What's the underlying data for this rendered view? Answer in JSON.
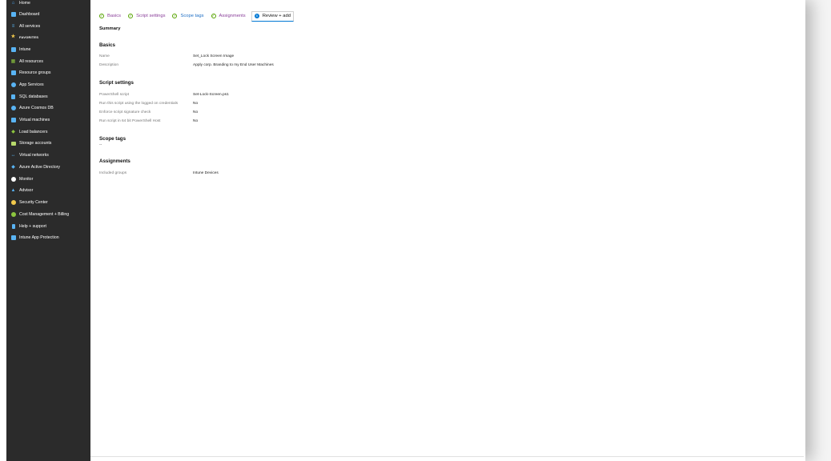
{
  "sidebar": {
    "items": [
      {
        "label": "Home",
        "icon": "home-icon",
        "color": "#4aa3f0"
      },
      {
        "label": "Dashboard",
        "icon": "dashboard-icon",
        "color": "#59b4f4"
      },
      {
        "label": "All services",
        "icon": "list-icon",
        "color": "#59b4f4"
      },
      {
        "label": "FAVORITES",
        "icon": "star-icon",
        "color": "#f2c94c"
      },
      {
        "label": "Intune",
        "icon": "intune-icon",
        "color": "#59b4f4"
      },
      {
        "label": "All resources",
        "icon": "grid-icon",
        "color": "#8dc63f"
      },
      {
        "label": "Resource groups",
        "icon": "resource-group-icon",
        "color": "#59b4f4"
      },
      {
        "label": "App Services",
        "icon": "app-services-icon",
        "color": "#59b4f4"
      },
      {
        "label": "SQL databases",
        "icon": "sql-database-icon",
        "color": "#59b4f4"
      },
      {
        "label": "Azure Cosmos DB",
        "icon": "cosmos-db-icon",
        "color": "#59b4f4"
      },
      {
        "label": "Virtual machines",
        "icon": "virtual-machine-icon",
        "color": "#59b4f4"
      },
      {
        "label": "Load balancers",
        "icon": "load-balancer-icon",
        "color": "#8dc63f"
      },
      {
        "label": "Storage accounts",
        "icon": "storage-icon",
        "color": "#b7d96b"
      },
      {
        "label": "Virtual networks",
        "icon": "virtual-network-icon",
        "color": "#59b4f4"
      },
      {
        "label": "Azure Active Directory",
        "icon": "active-directory-icon",
        "color": "#59b4f4"
      },
      {
        "label": "Monitor",
        "icon": "monitor-icon",
        "color": "#ffffff"
      },
      {
        "label": "Advisor",
        "icon": "advisor-icon",
        "color": "#59b4f4"
      },
      {
        "label": "Security Center",
        "icon": "security-center-icon",
        "color": "#f2c94c"
      },
      {
        "label": "Cost Management + Billing",
        "icon": "cost-management-icon",
        "color": "#8dc63f"
      },
      {
        "label": "Help + support",
        "icon": "help-icon",
        "color": "#59b4f4"
      },
      {
        "label": "Intune App Protection",
        "icon": "app-protection-icon",
        "color": "#59b4f4"
      }
    ]
  },
  "tabs": [
    {
      "label": "Basics",
      "state": "done"
    },
    {
      "label": "Script settings",
      "state": "done"
    },
    {
      "label": "Scope tags",
      "state": "done"
    },
    {
      "label": "Assignments",
      "state": "done"
    },
    {
      "label": "Review + add",
      "state": "active",
      "number": "5"
    }
  ],
  "summary": {
    "title": "Summary",
    "basics": {
      "heading": "Basics",
      "rows": [
        {
          "label": "Name",
          "value": "Set_Lock Screen Image"
        },
        {
          "label": "Description",
          "value": "Apply corp. Branding to my End User Machines"
        }
      ]
    },
    "script_settings": {
      "heading": "Script settings",
      "rows": [
        {
          "label": "PowerShell script",
          "value": "Set-Lock-Screen.ps1"
        },
        {
          "label": "Run this script using the logged on credentials",
          "value": "No"
        },
        {
          "label": "Enforce script signature check",
          "value": "No"
        },
        {
          "label": "Run script in 64 bit PowerShell Host",
          "value": "No"
        }
      ]
    },
    "scope_tags": {
      "heading": "Scope tags",
      "value": "--"
    },
    "assignments": {
      "heading": "Assignments",
      "rows": [
        {
          "label": "Included groups",
          "value": "Intune Devices"
        }
      ]
    }
  },
  "colors": {
    "sidebar_bg": "#2b2b2b",
    "accent": "#0078d4",
    "tab_purple": "#8a3f9a",
    "check_green": "#57a300"
  }
}
